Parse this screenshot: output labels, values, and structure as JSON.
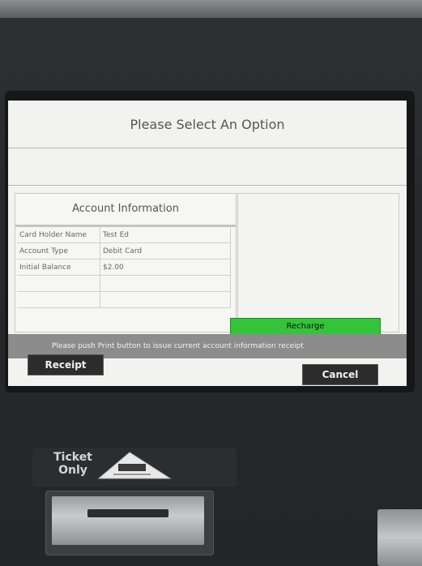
{
  "screen": {
    "title": "Please Select An Option"
  },
  "account_panel": {
    "title": "Account Information",
    "rows": [
      {
        "label": "Card Holder Name",
        "value": "Test Ed"
      },
      {
        "label": "Account Type",
        "value": "Debit Card"
      },
      {
        "label": "Initial Balance",
        "value": "$2.00"
      },
      {
        "label": "",
        "value": ""
      },
      {
        "label": "",
        "value": ""
      }
    ]
  },
  "actions": {
    "recharge_label": "Recharge",
    "receipt_label": "Receipt",
    "cancel_label": "Cancel"
  },
  "info": {
    "message": "Please push Print button to issue current account information receipt"
  },
  "hardware": {
    "ticket_label_line1": "Ticket",
    "ticket_label_line2": "Only"
  },
  "colors": {
    "recharge_green": "#33c43a",
    "info_bar_gray": "#8c8c8c",
    "button_dark": "#2c2c2c"
  }
}
